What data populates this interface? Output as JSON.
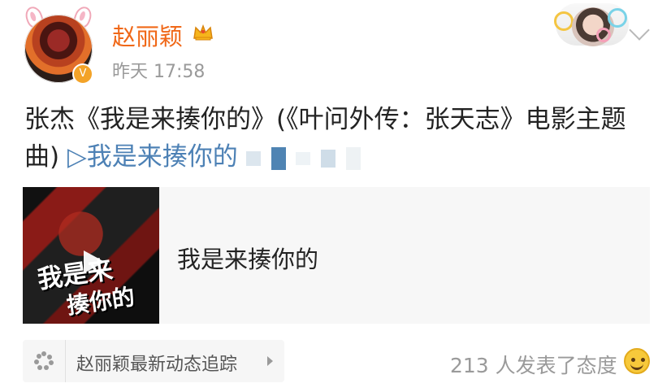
{
  "post": {
    "author": "赵丽颖",
    "time": "昨天 17:58",
    "text_before_link": "张杰《我是来揍你的》(《叶问外传：张天志》电影主题曲) ",
    "link_text": "▷我是来揍你的"
  },
  "card": {
    "title": "我是来揍你的",
    "thumbnail_title_line1": "我是来",
    "thumbnail_title_line2": "揍你的"
  },
  "footer": {
    "tracking_label": "赵丽颖最新动态追踪",
    "reaction_text": "213 人发表了态度"
  },
  "icons": {
    "crown": "crown-icon",
    "verified": "verified-badge-icon",
    "play": "play-icon",
    "more": "chevron-down-icon",
    "reaction": "smile-face-icon",
    "dots": "dots-icon"
  },
  "colors": {
    "username": "#f06818",
    "link": "#4d81b5",
    "meta_text": "#9a9a9a"
  }
}
